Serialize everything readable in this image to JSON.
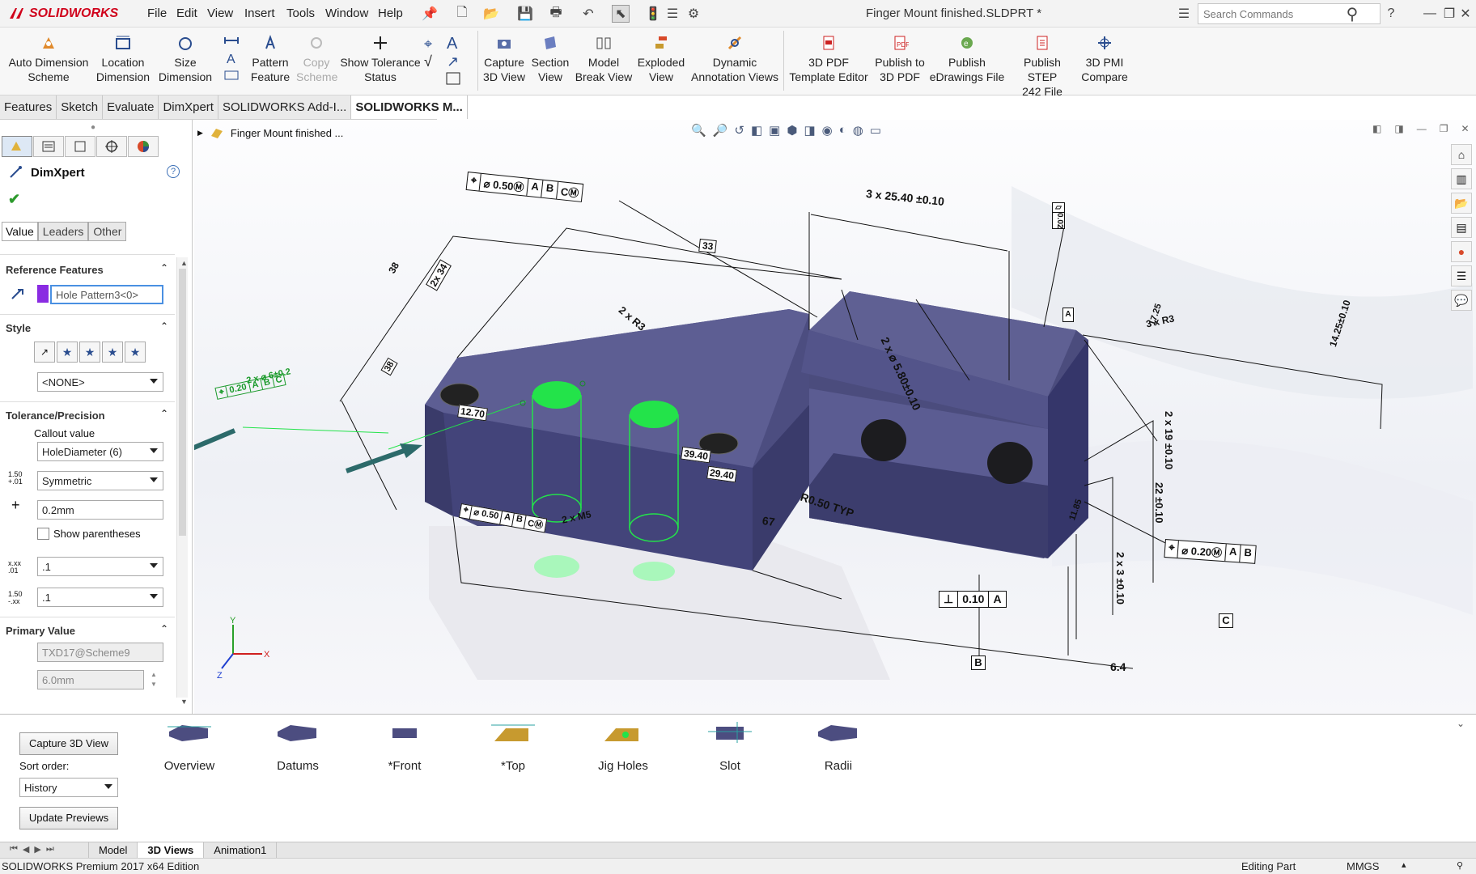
{
  "app": {
    "logo_text": "SOLIDWORKS",
    "document_title": "Finger Mount finished.SLDPRT *",
    "menus": [
      "File",
      "Edit",
      "View",
      "Insert",
      "Tools",
      "Window",
      "Help"
    ],
    "search_placeholder": "Search Commands"
  },
  "ribbon": {
    "buttons": [
      {
        "line1": "Auto Dimension",
        "line2": "Scheme"
      },
      {
        "line1": "Location",
        "line2": "Dimension"
      },
      {
        "line1": "Size",
        "line2": "Dimension"
      },
      {
        "line1": "Pattern",
        "line2": "Feature"
      },
      {
        "line1": "Copy",
        "line2": "Scheme"
      },
      {
        "line1": "Show Tolerance",
        "line2": "Status"
      },
      {
        "line1": "Capture",
        "line2": "3D View"
      },
      {
        "line1": "Section",
        "line2": "View"
      },
      {
        "line1": "Model",
        "line2": "Break View"
      },
      {
        "line1": "Exploded",
        "line2": "View"
      },
      {
        "line1": "Dynamic",
        "line2": "Annotation Views"
      },
      {
        "line1": "3D PDF",
        "line2": "Template Editor"
      },
      {
        "line1": "Publish to",
        "line2": "3D PDF"
      },
      {
        "line1": "Publish",
        "line2": "eDrawings File"
      },
      {
        "line1": "Publish STEP",
        "line2": "242 File"
      },
      {
        "line1": "3D PMI",
        "line2": "Compare"
      }
    ]
  },
  "tabs": [
    "Features",
    "Sketch",
    "Evaluate",
    "DimXpert",
    "SOLIDWORKS Add-I...",
    "SOLIDWORKS M..."
  ],
  "tree_item": "Finger Mount finished  ...",
  "property_manager": {
    "title": "DimXpert",
    "subtabs": [
      "Value",
      "Leaders",
      "Other"
    ],
    "reference_features": {
      "title": "Reference Features",
      "value": "Hole Pattern3<0>"
    },
    "style": {
      "title": "Style",
      "value": "<NONE>"
    },
    "tolerance": {
      "title": "Tolerance/Precision",
      "callout_label": "Callout value",
      "callout_value": "HoleDiameter (6)",
      "tol_type": "Symmetric",
      "tol_value": "0.2mm",
      "show_parentheses": "Show parentheses",
      "precision1": ".1",
      "precision2": ".1"
    },
    "primary_value": {
      "title": "Primary Value",
      "name": "TXD17@Scheme9",
      "value": "6.0mm"
    }
  },
  "annotations": {
    "fcf_top": [
      "⌖",
      "⌀ 0.50Ⓜ",
      "A",
      "B",
      "CⓂ"
    ],
    "dim_33": "33",
    "dim_38": "38",
    "dim_2x34": "2x 34",
    "dim_2xr3": "2 x R3",
    "dim_3x2540": "3 x 25.40 ±0.10",
    "dim_2x580": "2 x ⌀ 5.80±0.10",
    "dim_3xr3": "3 x R3",
    "dim_1425": "14.25±0.10",
    "dim_1725": "17.25",
    "dim_219": "2 x 19 ±0.10",
    "dim_22": "22 ±0.10",
    "dim_23": "2 x 3 ±0.10",
    "dim_1270": "12.70",
    "dim_3940": "39.40",
    "dim_2940": "29.40",
    "dim_r050": "R0.50 TYP",
    "dim_67": "67",
    "dim_64": "6.4",
    "dim_38b": "38",
    "dim_1185": "11.85",
    "hole_callout": "2 x ⌀ 6±0.2",
    "hole_fcf": [
      "⌖",
      "0.20",
      "A",
      "B",
      "C"
    ],
    "fcf_bottom": [
      "⌖",
      "⌀ 0.50",
      "A",
      "B",
      "CⓂ"
    ],
    "m5": "2 x M5",
    "fcf_right": [
      "⌖",
      "⌀ 0.20Ⓜ",
      "A",
      "B"
    ],
    "perp": [
      "⊥",
      "0.10",
      "A"
    ],
    "datum_b": "B",
    "datum_c": "C",
    "datum_a": "A",
    "flat_fcf": [
      "▱",
      "0.02"
    ]
  },
  "bottom": {
    "capture_button": "Capture 3D View",
    "sort_label": "Sort order:",
    "sort_value": "History",
    "update_button": "Update Previews",
    "views": [
      "Overview",
      "Datums",
      "*Front",
      "*Top",
      "Jig Holes",
      "Slot",
      "Radii"
    ]
  },
  "bottom_tabs": [
    "Model",
    "3D Views",
    "Animation1"
  ],
  "status": {
    "left": "SOLIDWORKS Premium 2017 x64 Edition",
    "mode": "Editing Part",
    "units": "MMGS"
  },
  "colors": {
    "part": "#4a4b7e",
    "highlight": "#23e34a",
    "annotation": "#111111",
    "arrow": "#2c6a6a"
  }
}
